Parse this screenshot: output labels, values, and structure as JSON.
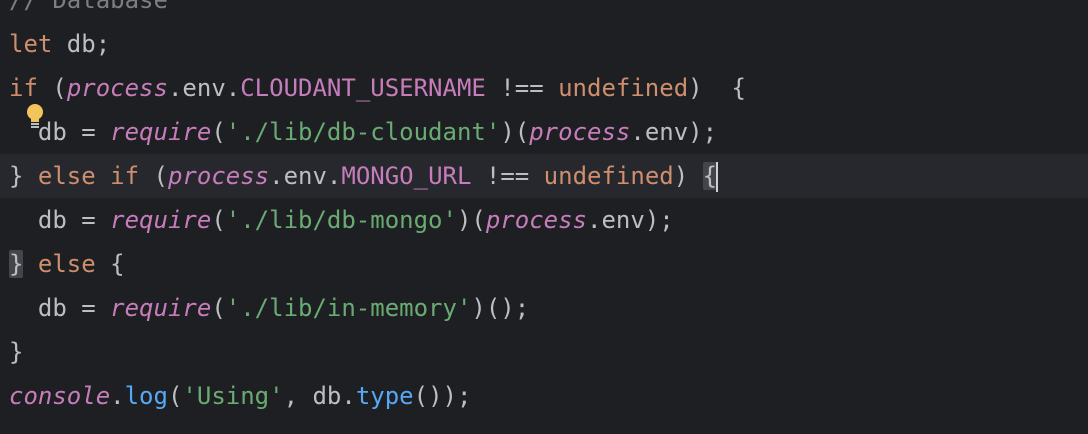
{
  "code": {
    "lines": [
      {
        "tokens": [
          {
            "t": "// Database",
            "c": "comment"
          }
        ]
      },
      {
        "tokens": [
          {
            "t": "let",
            "c": "kw"
          },
          {
            "t": " db;",
            "c": "plain"
          }
        ]
      },
      {
        "tokens": [
          {
            "t": "if",
            "c": "kw"
          },
          {
            "t": " (",
            "c": "plain"
          },
          {
            "t": "process",
            "c": "fn-italic"
          },
          {
            "t": ".env.",
            "c": "plain"
          },
          {
            "t": "CLOUDANT_USERNAME",
            "c": "const"
          },
          {
            "t": " !== ",
            "c": "plain"
          },
          {
            "t": "undefined",
            "c": "kw"
          },
          {
            "t": ")  {",
            "c": "plain"
          }
        ]
      },
      {
        "tokens": [
          {
            "t": "  db = ",
            "c": "plain"
          },
          {
            "t": "require",
            "c": "fn-italic"
          },
          {
            "t": "(",
            "c": "plain"
          },
          {
            "t": "'./lib/db-cloudant'",
            "c": "str"
          },
          {
            "t": ")(",
            "c": "plain"
          },
          {
            "t": "process",
            "c": "fn-italic"
          },
          {
            "t": ".env);",
            "c": "plain"
          }
        ]
      },
      {
        "tokens": [
          {
            "t": "} ",
            "c": "plain"
          },
          {
            "t": "else if",
            "c": "kw"
          },
          {
            "t": " (",
            "c": "plain"
          },
          {
            "t": "process",
            "c": "fn-italic"
          },
          {
            "t": ".env.",
            "c": "plain"
          },
          {
            "t": "MONGO_URL",
            "c": "const"
          },
          {
            "t": " !== ",
            "c": "plain"
          },
          {
            "t": "undefined",
            "c": "kw"
          },
          {
            "t": ") ",
            "c": "plain"
          },
          {
            "t": "{",
            "c": "brace"
          }
        ]
      },
      {
        "tokens": [
          {
            "t": "  db = ",
            "c": "plain"
          },
          {
            "t": "require",
            "c": "fn-italic"
          },
          {
            "t": "(",
            "c": "plain"
          },
          {
            "t": "'./lib/db-mongo'",
            "c": "str"
          },
          {
            "t": ")(",
            "c": "plain"
          },
          {
            "t": "process",
            "c": "fn-italic"
          },
          {
            "t": ".env);",
            "c": "plain"
          }
        ]
      },
      {
        "tokens": [
          {
            "t": "}",
            "c": "brace"
          },
          {
            "t": " ",
            "c": "plain"
          },
          {
            "t": "else",
            "c": "kw"
          },
          {
            "t": " {",
            "c": "plain"
          }
        ]
      },
      {
        "tokens": [
          {
            "t": "  db = ",
            "c": "plain"
          },
          {
            "t": "require",
            "c": "fn-italic"
          },
          {
            "t": "(",
            "c": "plain"
          },
          {
            "t": "'./lib/in-memory'",
            "c": "str"
          },
          {
            "t": ")();",
            "c": "plain"
          }
        ]
      },
      {
        "tokens": [
          {
            "t": "}",
            "c": "plain"
          }
        ]
      },
      {
        "tokens": [
          {
            "t": "console",
            "c": "fn-italic"
          },
          {
            "t": ".",
            "c": "plain"
          },
          {
            "t": "log",
            "c": "method"
          },
          {
            "t": "(",
            "c": "plain"
          },
          {
            "t": "'Using'",
            "c": "str"
          },
          {
            "t": ", db.",
            "c": "plain"
          },
          {
            "t": "type",
            "c": "method"
          },
          {
            "t": "());",
            "c": "plain"
          }
        ]
      }
    ],
    "current_line_index": 4,
    "caret_line_index": 4
  },
  "colors": {
    "background": "#1e1f22",
    "current_line": "#26282e",
    "keyword": "#cf8e6d",
    "string": "#6aab73",
    "italic_identifier": "#c77dbb",
    "method": "#56a8f5",
    "text": "#bcbec4"
  },
  "icons": {
    "intention_bulb": "lightbulb-icon"
  }
}
